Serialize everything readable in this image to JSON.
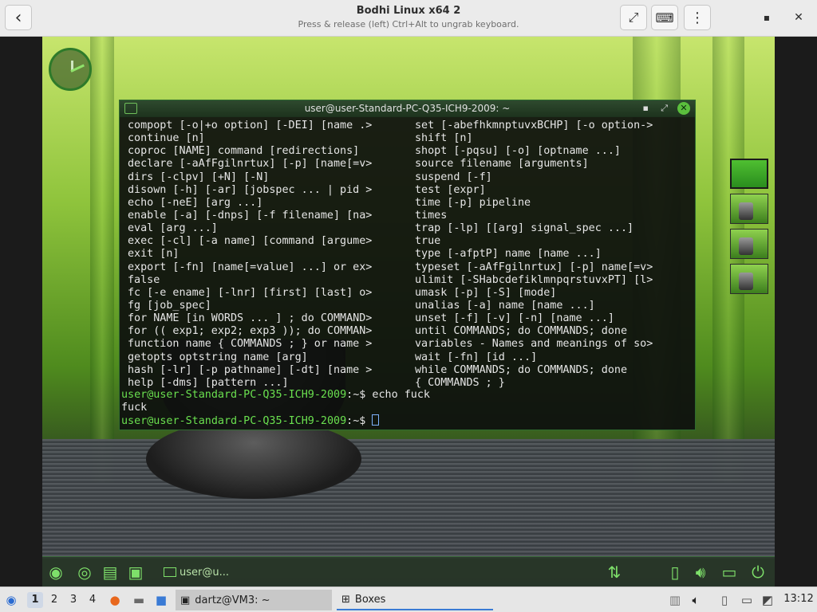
{
  "header": {
    "title": "Bodhi Linux x64 2",
    "subtitle": "Press & release (left) Ctrl+Alt to ungrab keyboard.",
    "back_icon": "‹",
    "fullscreen_icon": "⤢",
    "keyboard_icon": "⌨",
    "menu_icon": "⋮",
    "minimize_icon": "▪",
    "close_icon": "✕"
  },
  "terminal": {
    "title": "user@user-Standard-PC-Q35-ICH9-2009: ~",
    "left_column": [
      "compopt [-o|+o option] [-DEI] [name .>",
      "continue [n]",
      "coproc [NAME] command [redirections]",
      "declare [-aAfFgilnrtux] [-p] [name[=v>",
      "dirs [-clpv] [+N] [-N]",
      "disown [-h] [-ar] [jobspec ... | pid >",
      "echo [-neE] [arg ...]",
      "enable [-a] [-dnps] [-f filename] [na>",
      "eval [arg ...]",
      "exec [-cl] [-a name] [command [argume>",
      "exit [n]",
      "export [-fn] [name[=value] ...] or ex>",
      "false",
      "fc [-e ename] [-lnr] [first] [last] o>",
      "fg [job_spec]",
      "for NAME [in WORDS ... ] ; do COMMAND>",
      "for (( exp1; exp2; exp3 )); do COMMAN>",
      "function name { COMMANDS ; } or name >",
      "getopts optstring name [arg]",
      "hash [-lr] [-p pathname] [-dt] [name >",
      "help [-dms] [pattern ...]"
    ],
    "right_column": [
      "set [-abefhkmnptuvxBCHP] [-o option->",
      "shift [n]",
      "shopt [-pqsu] [-o] [optname ...]",
      "source filename [arguments]",
      "suspend [-f]",
      "test [expr]",
      "time [-p] pipeline",
      "times",
      "trap [-lp] [[arg] signal_spec ...]",
      "true",
      "type [-afptP] name [name ...]",
      "typeset [-aAfFgilnrtux] [-p] name[=v>",
      "ulimit [-SHabcdefiklmnpqrstuvxPT] [l>",
      "umask [-p] [-S] [mode]",
      "unalias [-a] name [name ...]",
      "unset [-f] [-v] [-n] [name ...]",
      "until COMMANDS; do COMMANDS; done",
      "variables - Names and meanings of so>",
      "wait [-fn] [id ...]",
      "while COMMANDS; do COMMANDS; done",
      "{ COMMANDS ; }"
    ],
    "prompt_user": "user@user-Standard-PC-Q35-ICH9-2009",
    "prompt_sep": ":~$ ",
    "command1": "echo fuck",
    "output1": "fuck"
  },
  "guest_panel": {
    "task_label": "user@u..."
  },
  "taskbar": {
    "workspaces": [
      "1",
      "2",
      "3",
      "4"
    ],
    "task1": "dartz@VM3: ~",
    "task2": "Boxes",
    "clock": "13:12"
  }
}
